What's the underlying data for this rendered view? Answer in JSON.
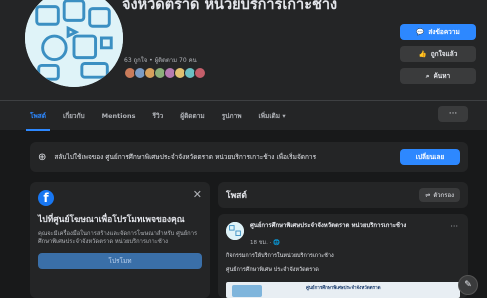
{
  "page": {
    "title": "จังหวัดตราด หน่วยบริการเกาะช้าง",
    "title_top_fragment": "",
    "meta": "63 ถูกใจ • ผู้ติดตาม 70 คน"
  },
  "actions": {
    "message": "ส่งข้อความ",
    "liked": "ถูกใจแล้ว",
    "search": "ค้นหา"
  },
  "tabs": [
    "โพสต์",
    "เกี่ยวกับ",
    "Mentions",
    "รีวิว",
    "ผู้ติดตาม",
    "รูปภาพ",
    "เพิ่มเติม ▾"
  ],
  "more_label": "···",
  "switch_bar": {
    "text": "สลับไปใช้เพจของ ศูนย์การศึกษาพิเศษประจำจังหวัดตราด หน่วยบริการเกาะช้าง เพื่อเริ่มจัดการ",
    "button": "เปลี่ยนเลย"
  },
  "promo": {
    "close": "✕",
    "title": "ไปที่ศูนย์โฆษณาเพื่อโปรโมทเพจของคุณ",
    "body": "คุณจะมีเครื่องมือในการสร้างและจัดการโฆษณาสำหรับ ศูนย์การศึกษาพิเศษประจำจังหวัดตราด หน่วยบริการเกาะช้าง",
    "button": "โปรโมท"
  },
  "posts": {
    "title": "โพสต์",
    "filter": "ตัวกรอง"
  },
  "post": {
    "author": "ศูนย์การศึกษาพิเศษประจำจังหวัดตราด หน่วยบริการเกาะช้าง",
    "time": "18 ชม. · 🌐",
    "text1": "กิจกรรมการให้บริการในหน่วยบริการเกาะช้าง",
    "text2": "ศูนย์การศึกษาพิเศษ ประจำจังหวัดตราด",
    "image_banner": "ศูนย์การศึกษาพิเศษประจำจังหวัดตราด",
    "dots": "···"
  },
  "colors": {
    "accent": "#2d88ff",
    "background": "#18191a",
    "surface": "#242526"
  }
}
